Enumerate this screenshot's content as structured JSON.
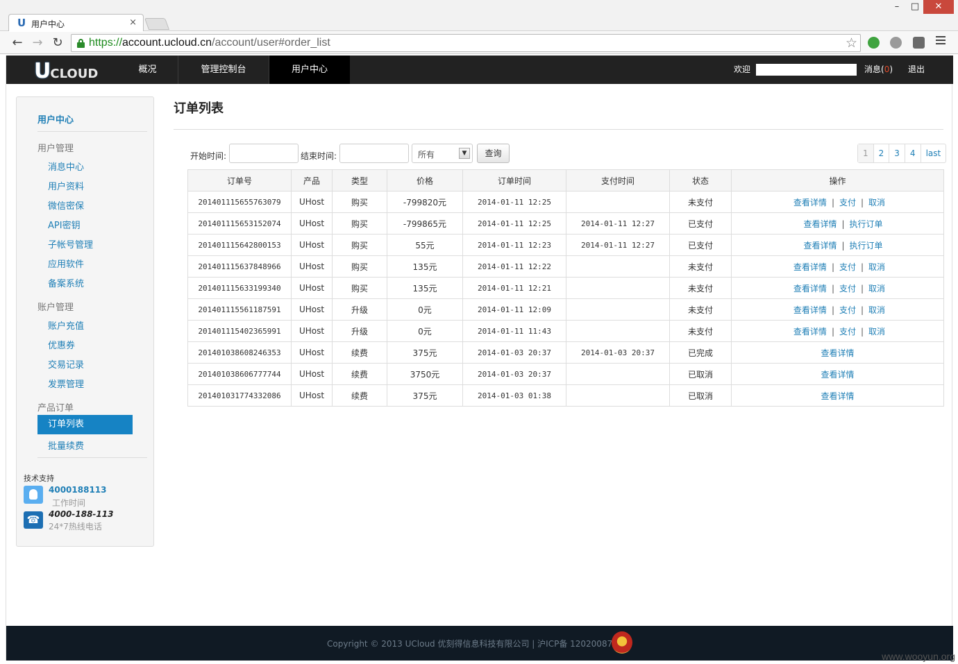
{
  "browser": {
    "tab_title": "用户中心",
    "tab_close": "×",
    "url_scheme": "https://",
    "url_host": "account.ucloud.cn",
    "url_path": "/account/user#order_list"
  },
  "topnav": {
    "logo_u": "U",
    "logo_rest": "CLOUD",
    "items": [
      "概况",
      "管理控制台",
      "用户中心"
    ],
    "welcome": "欢迎",
    "messages_label": "消息(",
    "messages_count": "0",
    "messages_close": ")",
    "logout": "退出"
  },
  "sidebar": {
    "title": "用户中心",
    "groups": [
      {
        "label": "用户管理",
        "items": [
          "消息中心",
          "用户资料",
          "微信密保",
          "API密钥",
          "子帐号管理",
          "应用软件",
          "备案系统"
        ]
      },
      {
        "label": "账户管理",
        "items": [
          "账户充值",
          "优惠券",
          "交易记录",
          "发票管理"
        ]
      },
      {
        "label": "产品订单",
        "items": [
          "订单列表",
          "批量续费"
        ]
      }
    ],
    "support": {
      "title": "技术支持",
      "qq_number": "4000188113",
      "qq_sub": "工作时间",
      "phone_number": "4000-188-113",
      "phone_sub": "24*7热线电话"
    }
  },
  "main": {
    "title": "订单列表",
    "filters": {
      "start_label": "开始时间:",
      "end_label": "结束时间:",
      "status_value": "所有",
      "query_button": "查询"
    },
    "pager": [
      "1",
      "2",
      "3",
      "4",
      "last"
    ],
    "columns": [
      "订单号",
      "产品",
      "类型",
      "价格",
      "订单时间",
      "支付时间",
      "状态",
      "操作"
    ],
    "rows": [
      {
        "id": "201401115655763079",
        "product": "UHost",
        "type": "购买",
        "price": "-799820元",
        "order_time": "2014-01-11 12:25",
        "pay_time": "",
        "status": "未支付",
        "ops": [
          "查看详情",
          "支付",
          "取消"
        ]
      },
      {
        "id": "201401115653152074",
        "product": "UHost",
        "type": "购买",
        "price": "-799865元",
        "order_time": "2014-01-11 12:25",
        "pay_time": "2014-01-11 12:27",
        "status": "已支付",
        "ops": [
          "查看详情",
          "执行订单"
        ]
      },
      {
        "id": "201401115642800153",
        "product": "UHost",
        "type": "购买",
        "price": "55元",
        "order_time": "2014-01-11 12:23",
        "pay_time": "2014-01-11 12:27",
        "status": "已支付",
        "ops": [
          "查看详情",
          "执行订单"
        ]
      },
      {
        "id": "201401115637848966",
        "product": "UHost",
        "type": "购买",
        "price": "135元",
        "order_time": "2014-01-11 12:22",
        "pay_time": "",
        "status": "未支付",
        "ops": [
          "查看详情",
          "支付",
          "取消"
        ]
      },
      {
        "id": "201401115633199340",
        "product": "UHost",
        "type": "购买",
        "price": "135元",
        "order_time": "2014-01-11 12:21",
        "pay_time": "",
        "status": "未支付",
        "ops": [
          "查看详情",
          "支付",
          "取消"
        ]
      },
      {
        "id": "201401115561187591",
        "product": "UHost",
        "type": "升级",
        "price": "0元",
        "order_time": "2014-01-11 12:09",
        "pay_time": "",
        "status": "未支付",
        "ops": [
          "查看详情",
          "支付",
          "取消"
        ]
      },
      {
        "id": "201401115402365991",
        "product": "UHost",
        "type": "升级",
        "price": "0元",
        "order_time": "2014-01-11 11:43",
        "pay_time": "",
        "status": "未支付",
        "ops": [
          "查看详情",
          "支付",
          "取消"
        ]
      },
      {
        "id": "201401038608246353",
        "product": "UHost",
        "type": "续费",
        "price": "375元",
        "order_time": "2014-01-03 20:37",
        "pay_time": "2014-01-03 20:37",
        "status": "已完成",
        "ops": [
          "查看详情"
        ]
      },
      {
        "id": "201401038606777744",
        "product": "UHost",
        "type": "续费",
        "price": "3750元",
        "order_time": "2014-01-03 20:37",
        "pay_time": "",
        "status": "已取消",
        "ops": [
          "查看详情"
        ]
      },
      {
        "id": "201401031774332086",
        "product": "UHost",
        "type": "续费",
        "price": "375元",
        "order_time": "2014-01-03 01:38",
        "pay_time": "",
        "status": "已取消",
        "ops": [
          "查看详情"
        ]
      }
    ]
  },
  "footer": {
    "text": "Copyright © 2013 UCloud 优刻得信息科技有限公司 | 沪ICP备 12020087"
  },
  "watermark": "www.wooyun.org"
}
